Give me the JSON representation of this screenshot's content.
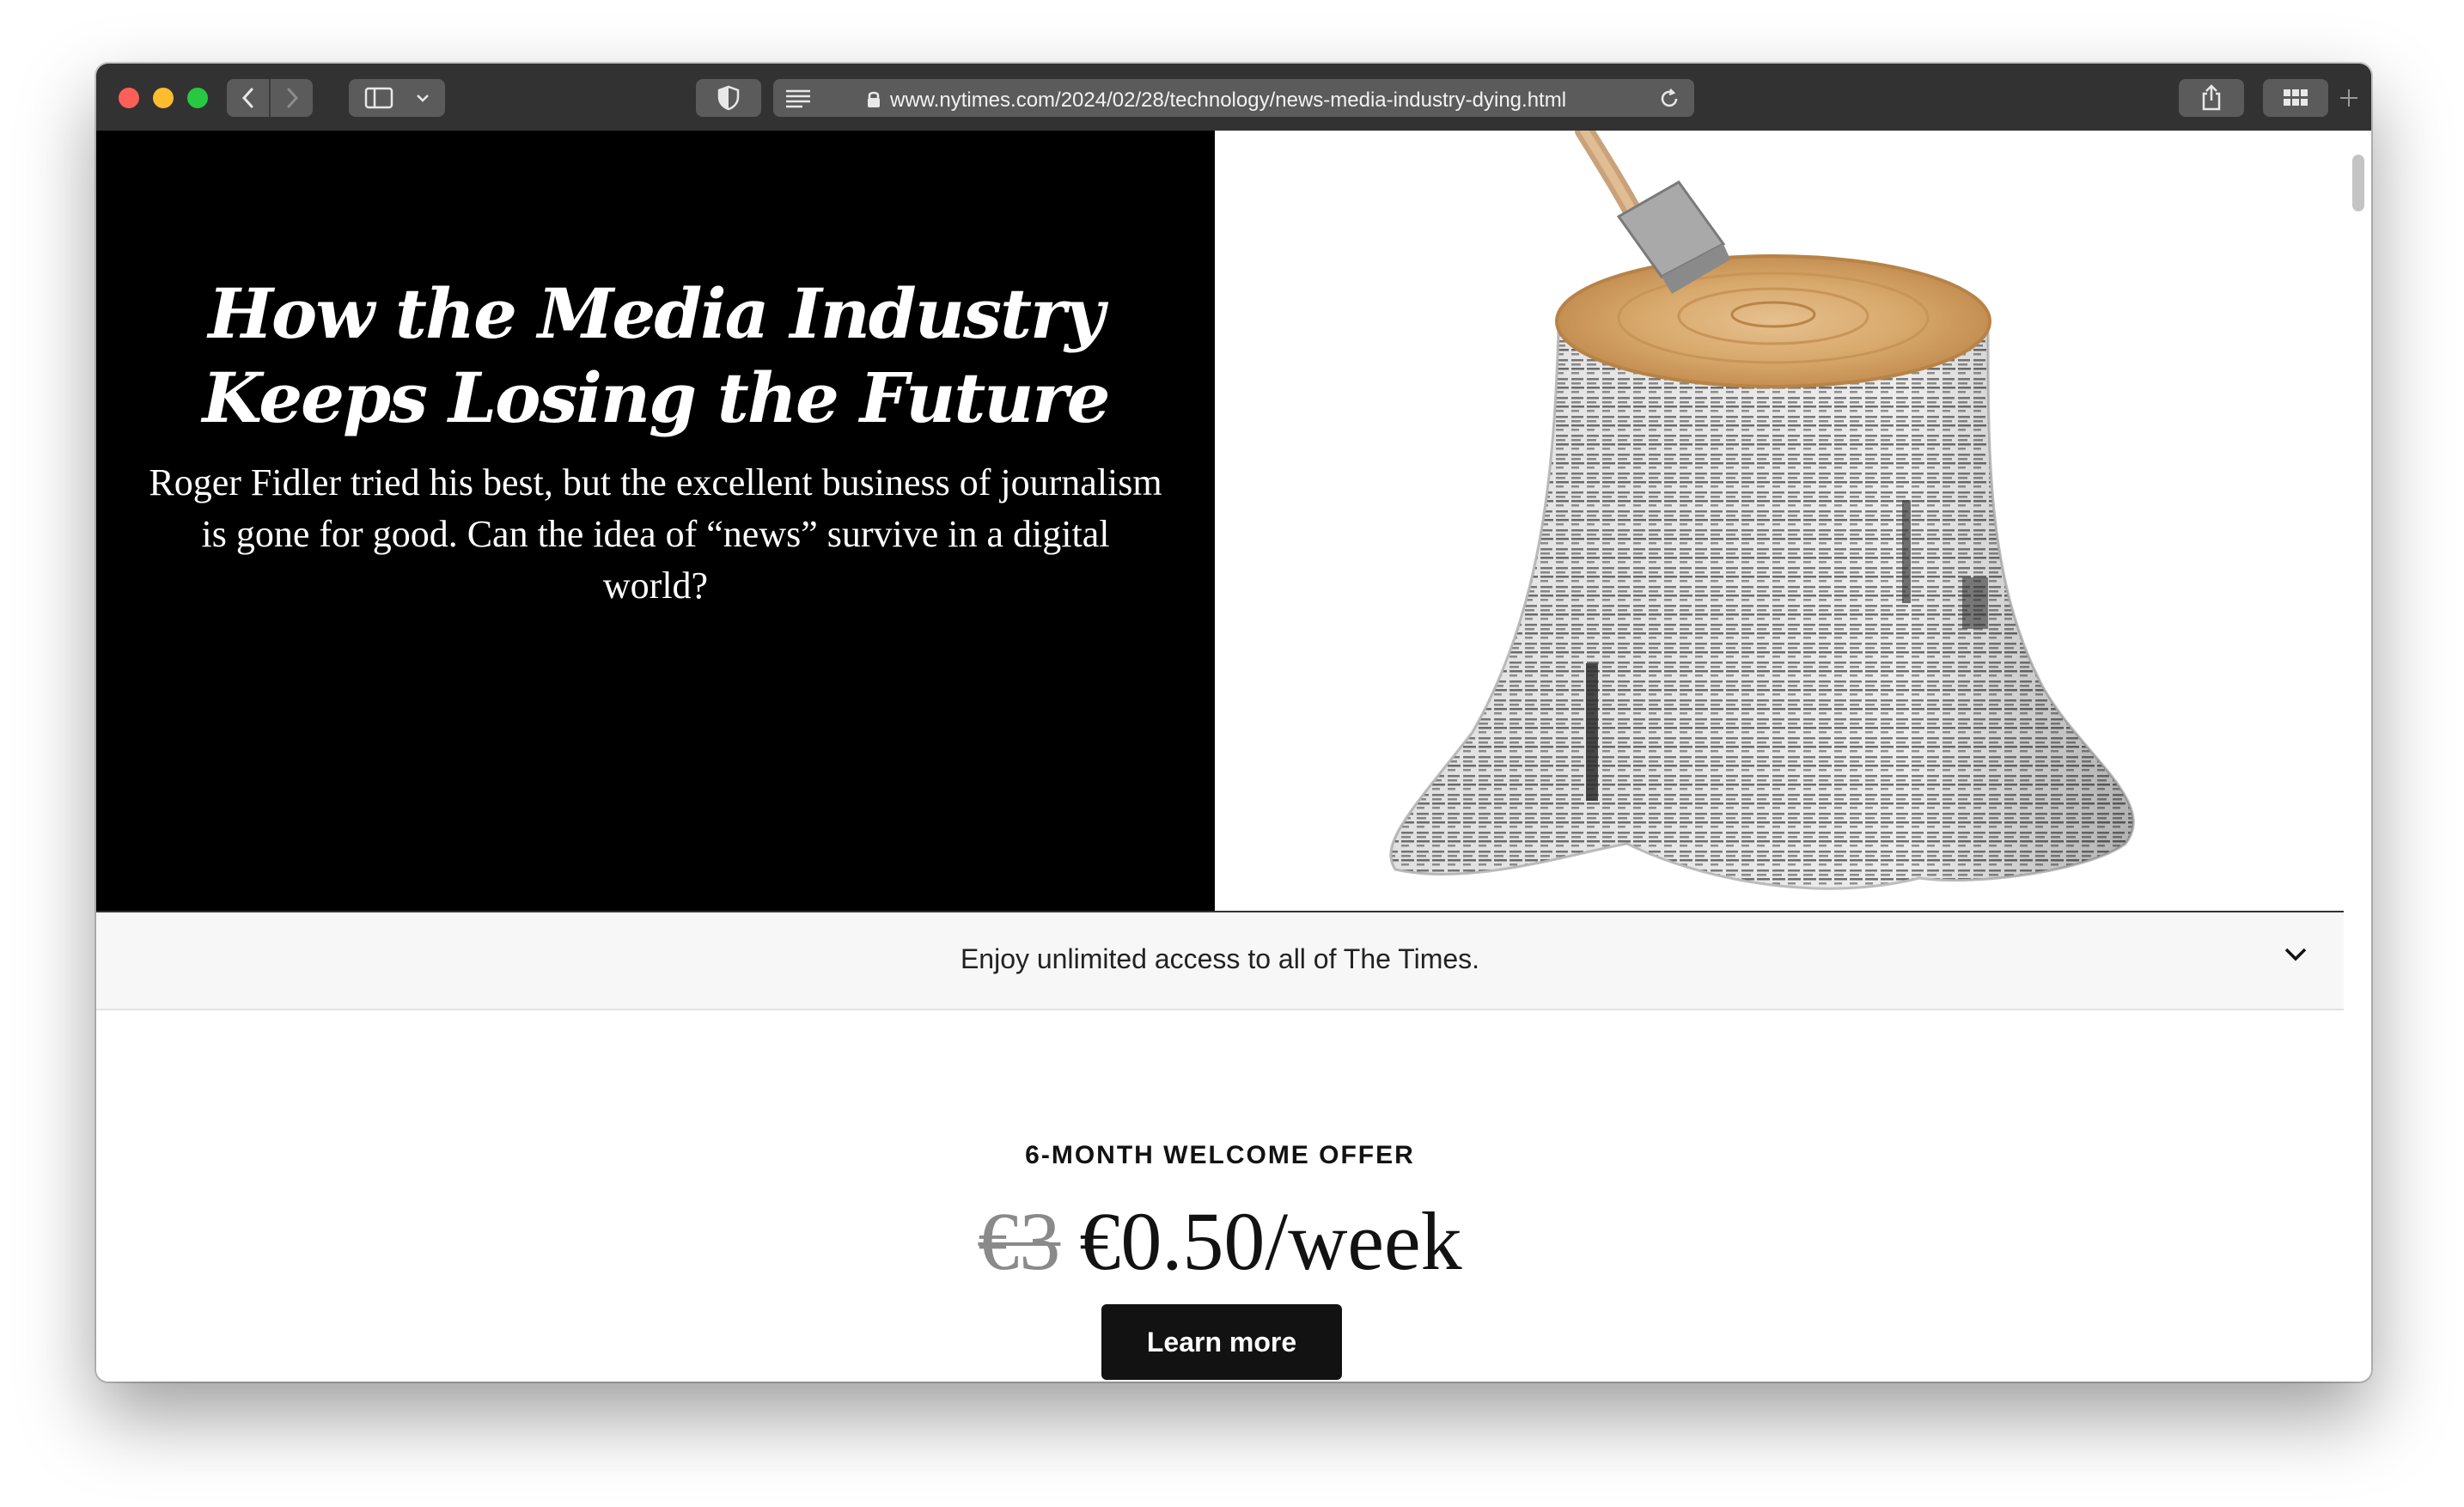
{
  "browser": {
    "url": "www.nytimes.com/2024/02/28/technology/news-media-industry-dying.html"
  },
  "article": {
    "headline_line1": "How the Media Industry",
    "headline_line2": "Keeps Losing the Future",
    "dek": "Roger Fidler tried his best, but the excellent business of journalism is gone for good. Can the idea of “news” survive in a digital world?"
  },
  "illustration": {
    "description_icon": "newspaper-tree-stump-with-axe"
  },
  "banner": {
    "text": "Enjoy unlimited access to all of The Times."
  },
  "offer": {
    "label": "6-MONTH WELCOME OFFER",
    "old_price": "€3",
    "new_price": "€0.50/week",
    "cta": "Learn more"
  },
  "colors": {
    "toolbar": "#323232",
    "hero_bg": "#000000",
    "button_bg": "#121212"
  }
}
